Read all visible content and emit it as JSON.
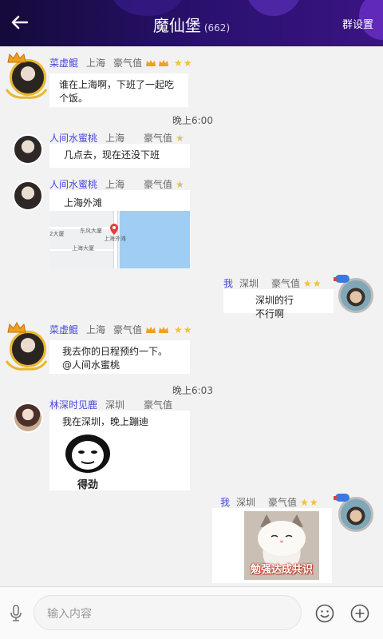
{
  "header": {
    "title": "魔仙堡",
    "member_count": "(662)",
    "settings_label": "群设置",
    "gradient": [
      "#150a3a",
      "#3a1482"
    ]
  },
  "messages": [
    {
      "name": "菜虚鲲",
      "city": "上海",
      "rank_label": "豪气值",
      "crowns": 2,
      "stars": 2,
      "text": "谁在上海啊，下班了一起吃个饭。"
    },
    {
      "time": "晚上6:00"
    },
    {
      "name": "人间水蜜桃",
      "city": "上海",
      "rank_label": "豪气值",
      "stars": 1,
      "text": "几点去，现在还没下班"
    },
    {
      "name": "人间水蜜桃",
      "city": "上海",
      "rank_label": "豪气值",
      "stars": 1,
      "text": "上海外滩",
      "map_labels": [
        "上海外滩",
        "2大厦",
        "东风大厦",
        "上海大厦"
      ]
    },
    {
      "name": "我",
      "city": "深圳",
      "rank_label": "豪气值",
      "stars": 2,
      "text": "深圳的行不行啊",
      "self": true
    },
    {
      "name": "菜虚鲲",
      "city": "上海",
      "rank_label": "豪气值",
      "crowns": 2,
      "stars": 2,
      "text_lines": [
        "我去你的日程预约一下。",
        "@人间水蜜桃"
      ]
    },
    {
      "time": "晚上6:03"
    },
    {
      "name": "林深时见鹿",
      "city": "深圳",
      "rank_label": "豪气值",
      "text": "我在深圳，晚上蹦迪",
      "sticker_caption": "得劲"
    },
    {
      "name": "我",
      "city": "深圳",
      "rank_label": "豪气值",
      "stars": 2,
      "self": true,
      "image_caption": "勉强达成共识"
    }
  ],
  "input": {
    "placeholder": "输入内容"
  },
  "icons": {
    "back": "arrow-left-icon",
    "voice": "microphone-icon",
    "emoji": "smiley-icon",
    "add": "plus-circle-icon"
  },
  "colors": {
    "name": "#4a48d8",
    "star": "#f1c232",
    "crown": "#f0a020"
  }
}
